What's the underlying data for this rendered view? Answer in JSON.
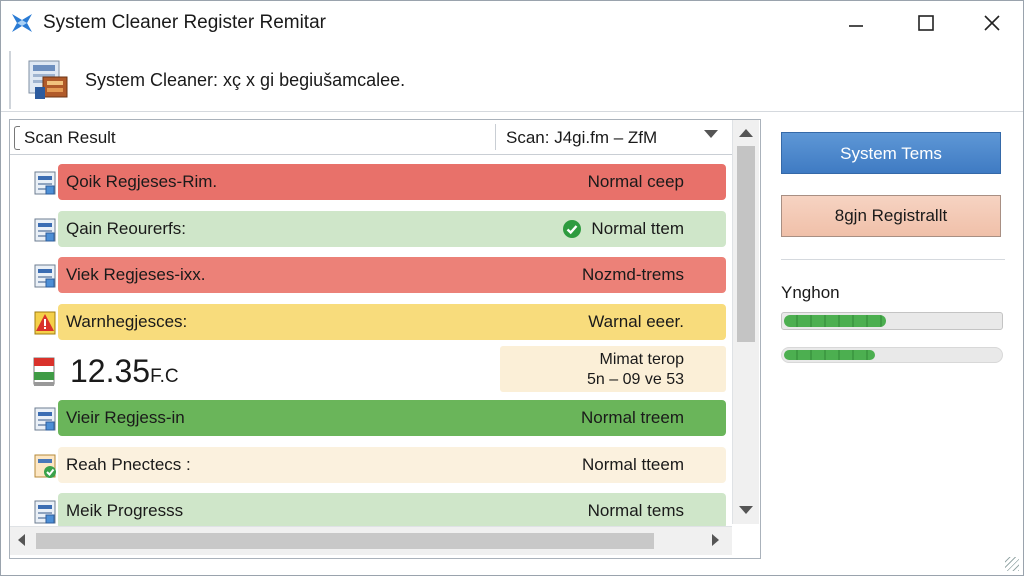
{
  "window": {
    "title": "System Cleaner Register Remitar",
    "minimize_icon": "minimize-icon",
    "maximize_icon": "maximize-icon",
    "close_icon": "close-icon"
  },
  "header": {
    "icon": "cleaner-app-icon",
    "text": "System Cleaner: xç x gi begiušamcalee."
  },
  "list": {
    "column_title": "Scan Result",
    "column_scan": "Scan: J4gi.fm – ZfM",
    "rows": [
      {
        "name": "Qoik Regjeses-Rim.",
        "status": "Normal ceep",
        "color": "#e8716a",
        "icon": "registry-file-icon",
        "check": false
      },
      {
        "name": "Qain Reourerfs:",
        "status": "Normal ttem",
        "color": "#cfe6c9",
        "icon": "registry-file-icon",
        "check": true
      },
      {
        "name": "Viek Regjeses-ixx.",
        "status": "Nozmd-trems",
        "color": "#ec8178",
        "icon": "registry-file-icon",
        "check": false
      },
      {
        "name": "Warnhegjesces:",
        "status": "Warnal eeer.",
        "color": "#f8dc7c",
        "icon": "warning-icon",
        "check": false
      }
    ],
    "big_row": {
      "value": "12.35",
      "unit": "F.C",
      "icon": "registry-size-icon",
      "side_line1": "Mimat terop",
      "side_line2": "5n – 09 ve 53"
    },
    "rows_after": [
      {
        "name": "Vieir Regjess-in",
        "status": "Normal treem",
        "color": "#6ab55a",
        "icon": "registry-file-icon",
        "check": false
      },
      {
        "name": "Reah Pnectecs :",
        "status": "Normal tteem",
        "color": "#fbf1de",
        "icon": "registry-check-icon",
        "check": false
      },
      {
        "name": "Meik Progresss",
        "status": "Normal tems",
        "color": "#cfe6c9",
        "icon": "registry-file-icon",
        "check": false
      }
    ]
  },
  "actions": {
    "primary": "System Tems",
    "secondary": "8gjn Registrallt"
  },
  "progress": {
    "label": "Ynghon",
    "bar1_fraction": 0.48,
    "bar2_fraction": 0.43
  }
}
